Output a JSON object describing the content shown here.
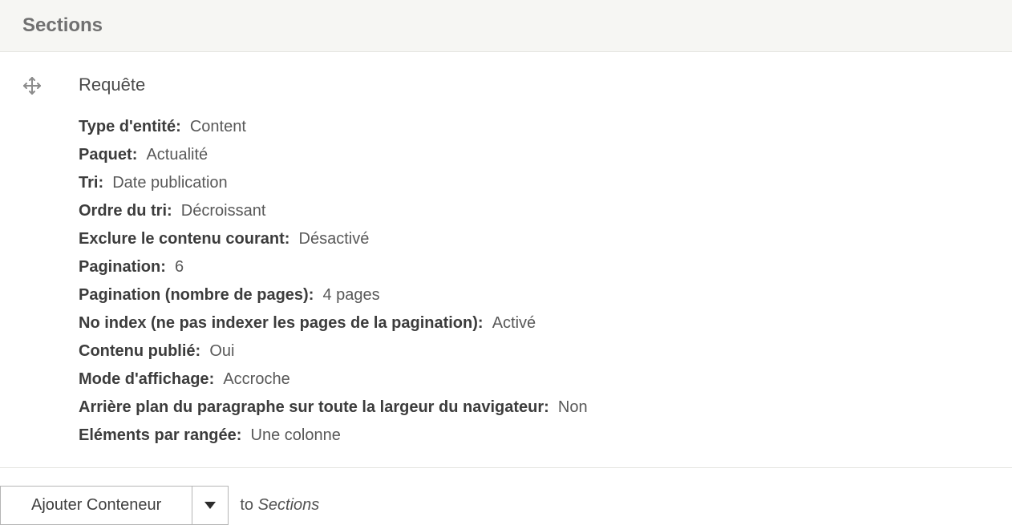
{
  "header": {
    "title": "Sections"
  },
  "entry": {
    "title": "Requête",
    "properties": [
      {
        "label": "Type d'entité",
        "value": "Content"
      },
      {
        "label": "Paquet",
        "value": "Actualité"
      },
      {
        "label": "Tri",
        "value": "Date publication"
      },
      {
        "label": "Ordre du tri",
        "value": "Décroissant"
      },
      {
        "label": "Exclure le contenu courant",
        "value": "Désactivé"
      },
      {
        "label": "Pagination",
        "value": "6"
      },
      {
        "label": "Pagination (nombre de pages)",
        "value": "4 pages"
      },
      {
        "label": "No index (ne pas indexer les pages de la pagination)",
        "value": "Activé"
      },
      {
        "label": "Contenu publié",
        "value": "Oui"
      },
      {
        "label": "Mode d'affichage",
        "value": "Accroche"
      },
      {
        "label": "Arrière plan du paragraphe sur toute la largeur du navigateur",
        "value": "Non"
      },
      {
        "label": "Eléments par rangée",
        "value": "Une colonne"
      }
    ]
  },
  "footer": {
    "button_label": "Ajouter Conteneur",
    "to_text": "to",
    "target": "Sections"
  }
}
